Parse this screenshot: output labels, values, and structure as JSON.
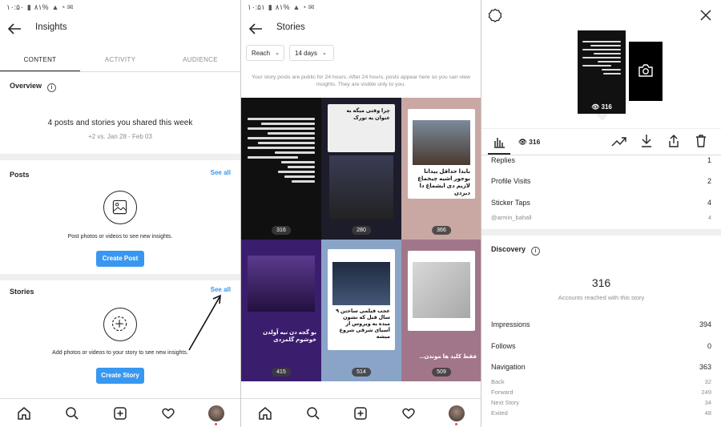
{
  "status_bar": {
    "left": "۱۰:۵۰",
    "battery": "٨١%",
    "left2": "۱۰:۵۱",
    "battery2": "٨١%"
  },
  "insights": {
    "title": "Insights",
    "tabs": [
      {
        "label": "CONTENT"
      },
      {
        "label": "ACTIVITY"
      },
      {
        "label": "AUDIENCE"
      }
    ],
    "overview": {
      "title": "Overview",
      "headline": "4 posts and stories you shared this week",
      "comparison": "+2 vs. Jan 28 - Feb 03"
    },
    "posts": {
      "title": "Posts",
      "see_all": "See all",
      "hint": "Post photos or videos to see new insights.",
      "button": "Create Post"
    },
    "stories": {
      "title": "Stories",
      "see_all": "See all",
      "hint": "Add photos or videos to your story to see new insights.",
      "button": "Create Story"
    }
  },
  "stories_page": {
    "title": "Stories",
    "filter_metric": "Reach",
    "filter_range": "14 days",
    "note": "Your story posts are public for 24 hours. After 24 hours, posts appear here so you can view insights. They are visible only to you.",
    "tiles": [
      {
        "count": "316",
        "bg": "#101010",
        "caption": "آقایی که اومدین بحث دادین در آبادی"
      },
      {
        "count": "280",
        "bg": "#1c1c2a",
        "caption": "چرا وقتی میگه به عنوان یه تورک"
      },
      {
        "count": "366",
        "bg": "#c9a8a4",
        "caption": "بابدا حداقل بیدانا بوجور اشیه چیخماغ لازیم دی ایشماغ دا دیزدن"
      },
      {
        "count": "415",
        "bg": "#3b1d6e",
        "caption": "بو گجه دن نیه آولدن خوشوم گلمزدی"
      },
      {
        "count": "514",
        "bg": "#8aa4c8",
        "caption": "عجب فیلمی ساختن ۹ سال قبل که نشون میده یه ویروس از آسیای شرقی شروع میشه"
      },
      {
        "count": "509",
        "bg": "#a2768a",
        "caption": "فقط کلید ها موندن..."
      }
    ]
  },
  "story_detail": {
    "views": "316",
    "thumb_count": "316",
    "interactions": [
      {
        "label": "Replies",
        "value": "1"
      },
      {
        "label": "Profile Visits",
        "value": "2"
      },
      {
        "label": "Sticker Taps",
        "value": "4"
      }
    ],
    "sticker_user": {
      "label": "@armin_bahall",
      "value": "4"
    },
    "discovery": {
      "title": "Discovery",
      "reach": "316",
      "reach_label": "Accounts reached with this story",
      "impressions": {
        "label": "Impressions",
        "value": "394"
      },
      "follows": {
        "label": "Follows",
        "value": "0"
      },
      "navigation": {
        "label": "Navigation",
        "value": "363"
      },
      "nav_breakdown": [
        {
          "label": "Back",
          "value": "32"
        },
        {
          "label": "Forward",
          "value": "249"
        },
        {
          "label": "Next Story",
          "value": "34"
        },
        {
          "label": "Exited",
          "value": "48"
        }
      ]
    }
  },
  "colors": {
    "accent": "#3897f0",
    "text": "#262626",
    "muted": "#8e8e8e",
    "divider": "#efefef"
  },
  "icons": [
    "back-arrow-icon",
    "info-icon",
    "image-icon",
    "add-story-icon",
    "home-icon",
    "search-icon",
    "new-post-icon",
    "heart-icon",
    "settings-icon",
    "close-icon",
    "camera-icon",
    "bar-chart-icon",
    "eye-icon",
    "trend-icon",
    "download-icon",
    "share-icon",
    "trash-icon"
  ]
}
